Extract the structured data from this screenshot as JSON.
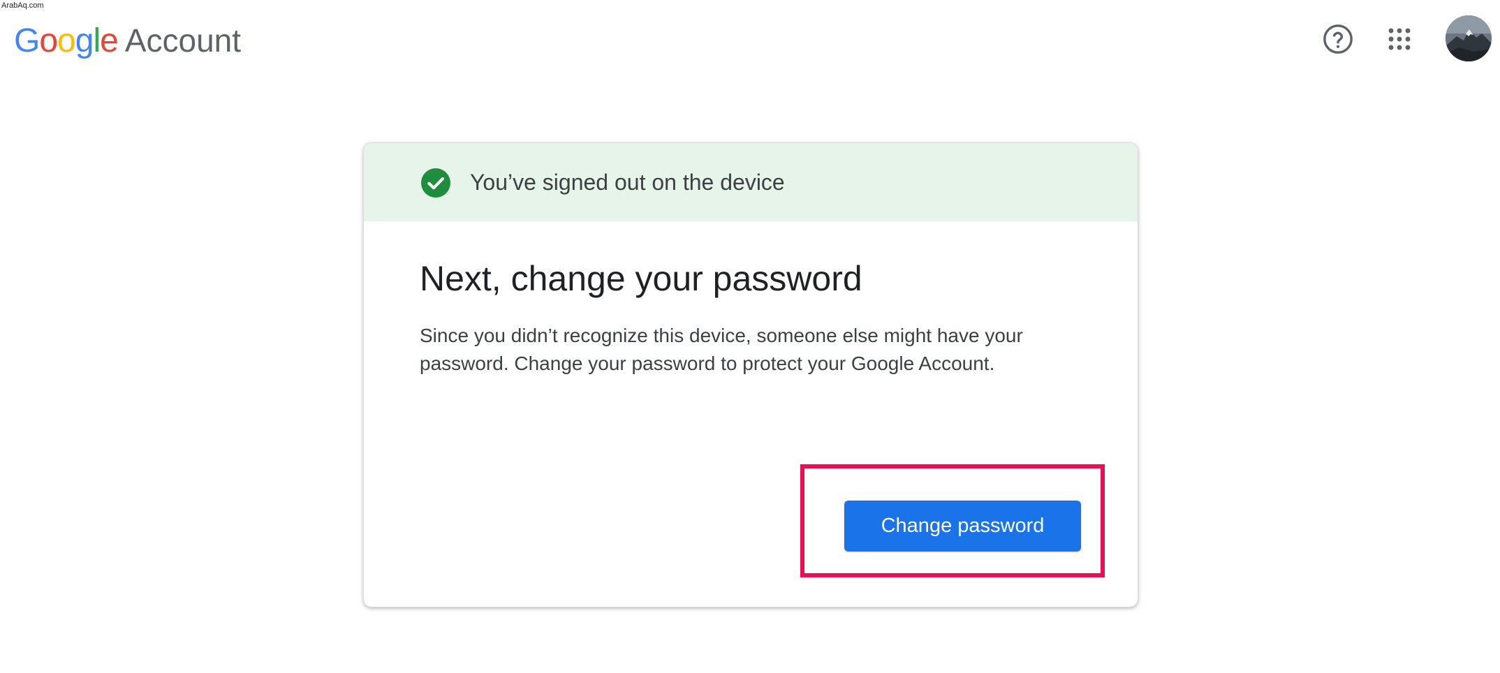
{
  "watermark": "ArabAq.com",
  "header": {
    "brand_letters": [
      "G",
      "o",
      "o",
      "g",
      "l",
      "e"
    ],
    "product": "Account",
    "help_icon": "help-circle-icon",
    "apps_icon": "apps-grid-icon",
    "avatar_icon": "account-avatar"
  },
  "card": {
    "banner_icon": "check-circle-icon",
    "banner_text": "You’ve signed out on the device",
    "heading": "Next, change your password",
    "body_line1": "Since you didn’t recognize this device, someone else might have your",
    "body_line2": "password. Change your password to protect your Google Account.",
    "button_label": "Change password"
  },
  "colors": {
    "primary": "#1a73e8",
    "success": "#1e8e3e",
    "banner_bg": "#e6f4ea",
    "highlight_border": "#eb0e57"
  }
}
